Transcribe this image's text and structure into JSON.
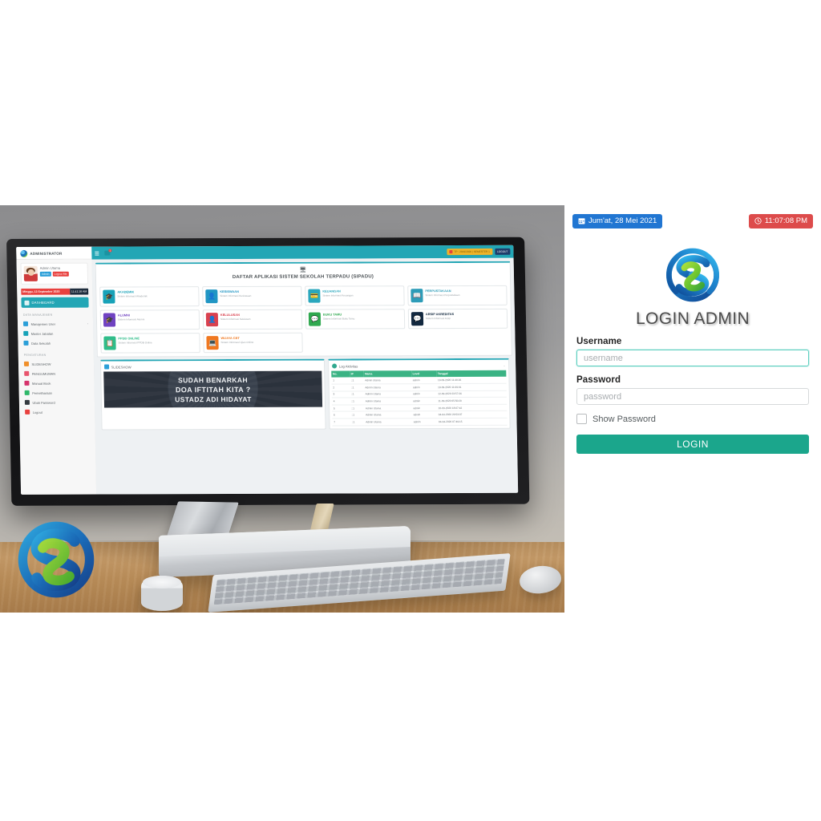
{
  "login": {
    "date_badge": {
      "icon": "calendar-icon",
      "text": "Jum'at,  28 Mei  2021",
      "color": "#2176d2"
    },
    "time_badge": {
      "icon": "clock-icon",
      "text": "11:07:08 PM",
      "color": "#dd4b4b"
    },
    "logo_alt": "sipadu-logo",
    "title": "LOGIN ADMIN",
    "username": {
      "label": "Username",
      "value": "",
      "placeholder": "username"
    },
    "password": {
      "label": "Password",
      "value": "",
      "placeholder": "password"
    },
    "show_password": {
      "label": "Show Password",
      "checked": false
    },
    "submit": {
      "label": "LOGIN",
      "color": "#1ba68c"
    }
  },
  "photo": {
    "screen": {
      "brand": "ADMINISTRATOR",
      "topbar": {
        "menu_icon": "hamburger-icon",
        "notification_icon": "bell-icon",
        "notification_count": "1",
        "term_badge": "TP : 2019/2020 | SEMESTER 1",
        "logout_badge": "LOGOUT"
      },
      "user": {
        "name": "Admin Utama",
        "role_tag": "Admin",
        "logout_tag": "Logout Me"
      },
      "datetime": {
        "date": "Minggu, 13 September 2020",
        "time": "11:41:16 AM"
      },
      "dashboard_item": "DASHBOARD",
      "sections": [
        {
          "title": "DATA MANAJEMEN",
          "items": [
            {
              "label": "Manajemen User",
              "icon": "user-icon",
              "color": "#2b9fd8",
              "caret": "‹"
            },
            {
              "label": "Master Jabatan",
              "icon": "briefcase-icon",
              "color": "#17a2b8",
              "caret": ""
            },
            {
              "label": "Data Sekolah",
              "icon": "bank-icon",
              "color": "#2b9fd8",
              "caret": ""
            }
          ]
        },
        {
          "title": "PENGATURAN",
          "items": [
            {
              "label": "SLIDESHOW",
              "icon": "image-icon",
              "color": "#f0902b",
              "caret": ""
            },
            {
              "label": "PENGUMUMAN",
              "icon": "megaphone-icon",
              "color": "#e8556d",
              "caret": ""
            },
            {
              "label": "Manual Book",
              "icon": "book-icon",
              "color": "#d6336c",
              "caret": ""
            },
            {
              "label": "Pemeliharaan",
              "icon": "wrench-icon",
              "color": "#2fb86a",
              "caret": ""
            },
            {
              "label": "Ubah Password",
              "icon": "lock-icon",
              "color": "#343a40",
              "caret": ""
            },
            {
              "label": "Logout",
              "icon": "signout-icon",
              "color": "#e8413f",
              "caret": ""
            }
          ]
        }
      ],
      "content_header": {
        "icon": "desktop-icon",
        "title": "DAFTAR APLIKASI SISTEM SEKOLAH TERPADU (SIPADU)"
      },
      "apps": [
        {
          "name": "AKADEMIK",
          "desc": "Sistem Informasi Akademik",
          "color": "#17a2b8",
          "glyph": "🎓"
        },
        {
          "name": "KESISWAAN",
          "desc": "Sistem Informasi Kesiswaan",
          "color": "#2196c4",
          "glyph": "📇"
        },
        {
          "name": "KEUANGAN",
          "desc": "Sistem Informasi Keuangan",
          "color": "#2aa7bd",
          "glyph": "💳"
        },
        {
          "name": "PERPUSTAKAAN",
          "desc": "Sistem Informasi Perpustakaan",
          "color": "#2d9cb8",
          "glyph": "📖"
        },
        {
          "name": "ALUMNI",
          "desc": "Sistem Informasi Alumni",
          "color": "#6f42c1",
          "glyph": "🎓"
        },
        {
          "name": "KELULUSAN",
          "desc": "Sistem Informasi Kelulusan",
          "color": "#d9414f",
          "glyph": "👤"
        },
        {
          "name": "BUKU TAMU",
          "desc": "Sistem Informasi Buku Tamu",
          "color": "#2fa84f",
          "glyph": "💬"
        },
        {
          "name": "ARSIP AKREDITAS",
          "desc": "Sistem Informasi Arsip",
          "color": "#12283f",
          "glyph": "💬"
        },
        {
          "name": "PPDB ONLINE",
          "desc": "Sistem Informasi PPDB Online",
          "color": "#2fbd8a",
          "glyph": "📋"
        },
        {
          "name": "WIJAYA CBT",
          "desc": "Sistem Informasi Ujian Online",
          "color": "#f07820",
          "glyph": "💻"
        }
      ],
      "slideshow": {
        "panel_title": "SLIDESHOW",
        "icon": "image-icon",
        "line1": "SUDAH BENARKAH",
        "line2": "DOA IFTITAH KITA ?",
        "line3": "USTADZ ADI HIDAYAT"
      },
      "log": {
        "panel_title": "Log Aktivitas",
        "icon": "history-icon",
        "columns": [
          "No.",
          "IP",
          "Nama",
          "Level",
          "Tanggal"
        ],
        "rows": [
          [
            "1",
            "::1",
            "Admin Utama",
            "admin",
            "13-09-2020 11:40:26"
          ],
          [
            "2",
            "::1",
            "Admin Utama",
            "admin",
            "13-09-2020 11:09:01"
          ],
          [
            "3",
            "::1",
            "Admin Utama",
            "admin",
            "12-09-2020 23:57:26"
          ],
          [
            "4",
            "::1",
            "Admin Utama",
            "admin",
            "11-09-2020 05:50:20"
          ],
          [
            "5",
            "::1",
            "Admin Utama",
            "admin",
            "10-09-2020 18:07:42"
          ],
          [
            "6",
            "::1",
            "Admin Utama",
            "admin",
            "04-04-2020 20:53:37"
          ],
          [
            "7",
            "::1",
            "Admin Utama",
            "admin",
            "04-04-2020 07:49:15"
          ]
        ]
      }
    },
    "watermark_logo": "sipadu-logo"
  }
}
